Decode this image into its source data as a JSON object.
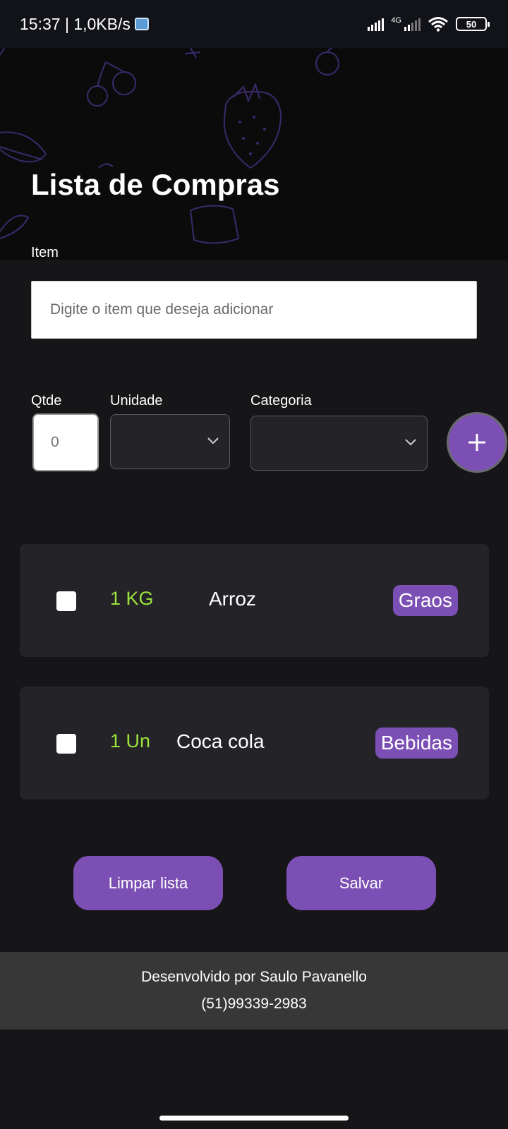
{
  "status_bar": {
    "time_speed": "15:37 | 1,0KB/s",
    "network_type": "4G",
    "battery": "50"
  },
  "header": {
    "title": "Lista de Compras"
  },
  "form": {
    "item_label": "Item",
    "item_placeholder": "Digite o item que deseja adicionar",
    "qtde_label": "Qtde",
    "qtde_value": "0",
    "unidade_label": "Unidade",
    "unidade_value": "",
    "categoria_label": "Categoria",
    "categoria_value": "",
    "add_icon": "plus-icon"
  },
  "items": [
    {
      "checked": false,
      "quantity": "1 KG",
      "name": "Arroz",
      "category": "Graos"
    },
    {
      "checked": false,
      "quantity": "1 Un",
      "name": "Coca cola",
      "category": "Bebidas"
    }
  ],
  "actions": {
    "clear_label": "Limpar lista",
    "save_label": "Salvar"
  },
  "footer": {
    "credit": "Desenvolvido por Saulo Pavanello",
    "phone": "(51)99339-2983"
  },
  "colors": {
    "accent": "#7b4fb4",
    "quantity_text": "#9be33a",
    "background": "#161618",
    "card": "#242428"
  }
}
